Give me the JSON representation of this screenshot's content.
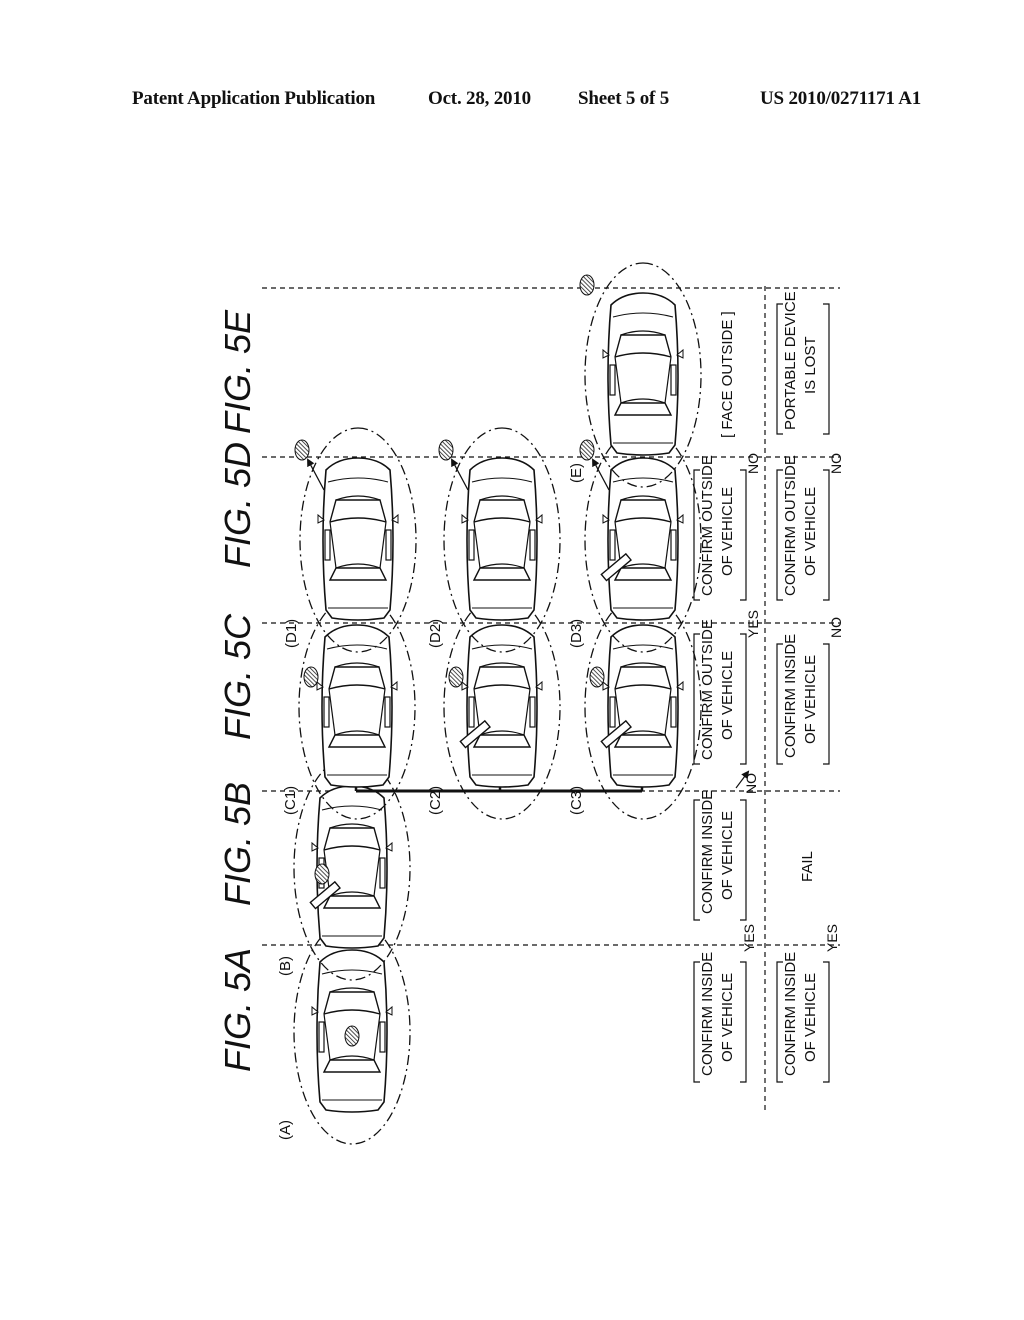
{
  "header": {
    "publication_label": "Patent Application Publication",
    "date": "Oct. 28, 2010",
    "sheet": "Sheet 5 of 5",
    "number": "US 2010/0271171 A1"
  },
  "figures": [
    {
      "id": "5A",
      "label": "FIG. 5A"
    },
    {
      "id": "5B",
      "label": "FIG. 5B"
    },
    {
      "id": "5C",
      "label": "FIG. 5C"
    },
    {
      "id": "5D",
      "label": "FIG. 5D"
    },
    {
      "id": "5E",
      "label": "FIG. 5E"
    }
  ],
  "scenes": {
    "A": {
      "label": "(A)",
      "device": "inside",
      "door_open": false
    },
    "B": {
      "label": "(B)",
      "device": "door",
      "door_open": true
    },
    "C1": {
      "label": "(C1)",
      "device": "near-outside",
      "door_open": false
    },
    "C2": {
      "label": "(C2)",
      "device": "near-outside",
      "door_open": true
    },
    "C3": {
      "label": "(C3)",
      "device": "near-outside",
      "door_open": true
    },
    "D1": {
      "label": "(D1)",
      "device": "far-outside",
      "door_open": false
    },
    "D2": {
      "label": "(D2)",
      "device": "far-outside",
      "door_open": false
    },
    "D3": {
      "label": "(D3)",
      "device": "far-outside",
      "door_open": true
    },
    "E": {
      "label": "(E)",
      "device": "far-outside",
      "door_open": false
    }
  },
  "row1": {
    "A": {
      "line1": "CONFIRM INSIDE",
      "line2": "OF VEHICLE",
      "answer": "YES"
    },
    "B": {
      "line1": "CONFIRM INSIDE",
      "line2": "OF VEHICLE",
      "answer": "NO"
    },
    "C": {
      "line1": "CONFIRM OUTSIDE",
      "line2": "OF VEHICLE",
      "answer": "YES"
    },
    "D": {
      "line1": "CONFIRM OUTSIDE",
      "line2": "OF VEHICLE",
      "answer": "NO"
    },
    "E": {
      "line1": "[ FACE OUTSIDE ]"
    }
  },
  "row2": {
    "A": {
      "line1": "CONFIRM INSIDE",
      "line2": "OF VEHICLE",
      "answer": "YES"
    },
    "B": {
      "text": "FAIL"
    },
    "C": {
      "line1": "CONFIRM INSIDE",
      "line2": "OF VEHICLE",
      "answer": "NO"
    },
    "D": {
      "line1": "CONFIRM OUTSIDE",
      "line2": "OF VEHICLE",
      "answer": "NO"
    },
    "E": {
      "line1": "PORTABLE DEVICE",
      "line2": "IS LOST"
    }
  }
}
